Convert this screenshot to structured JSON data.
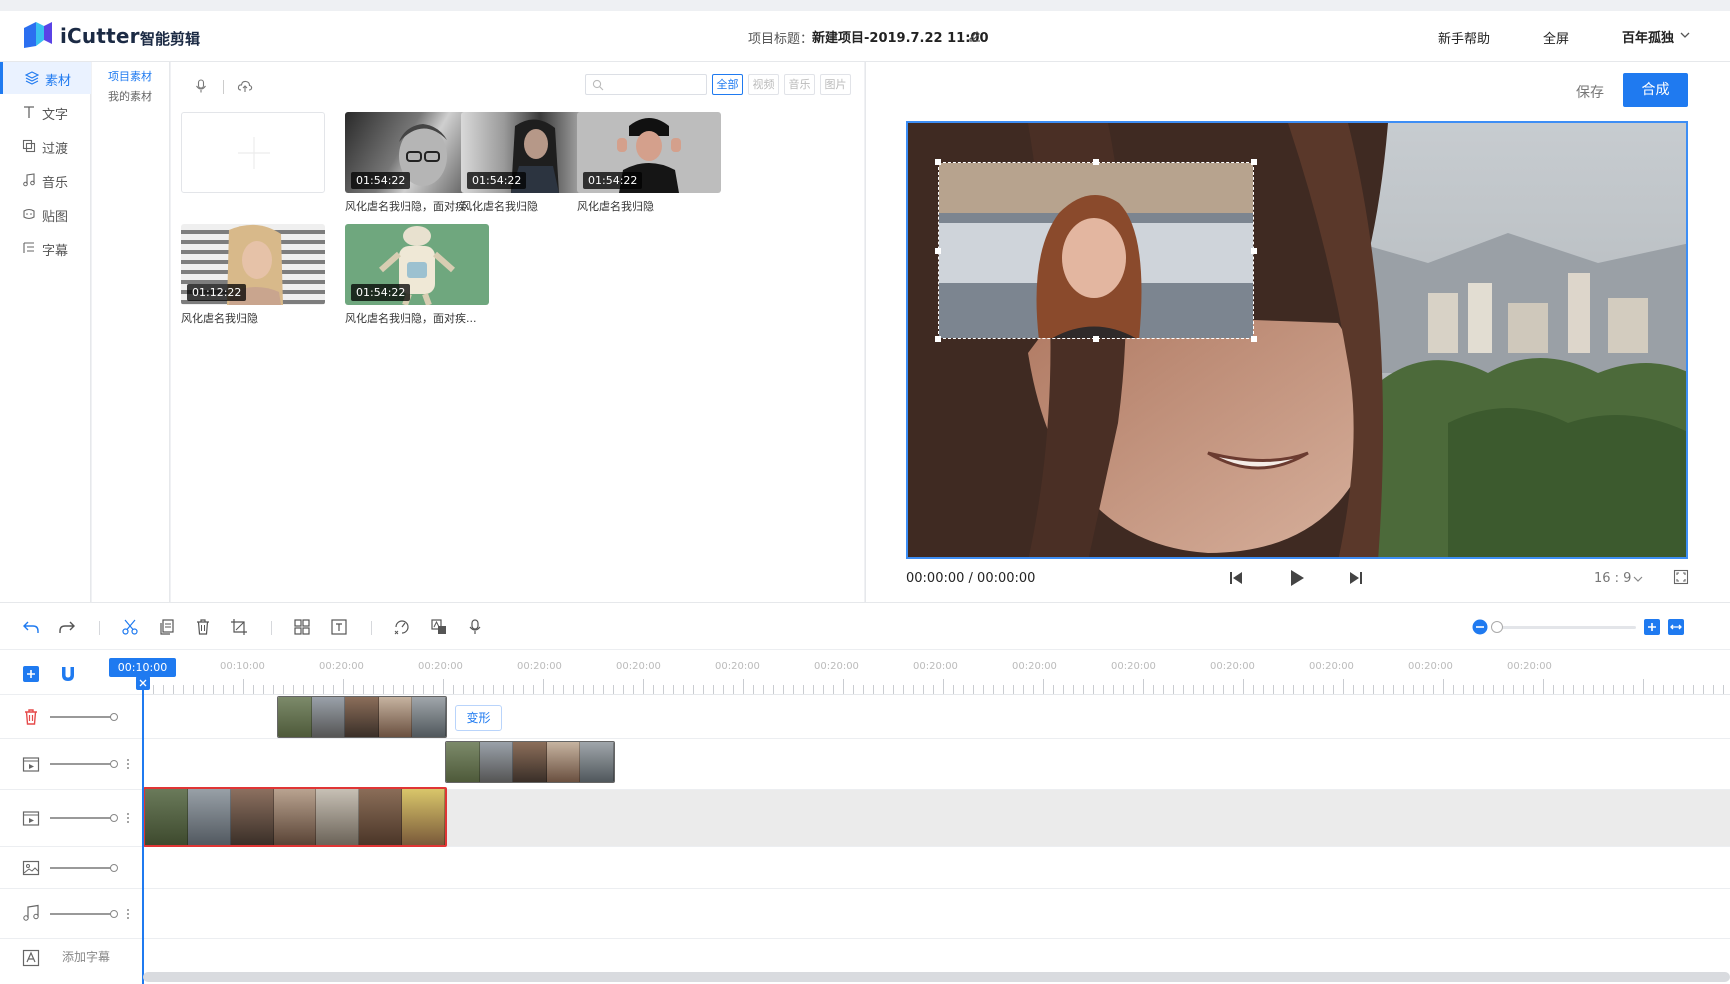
{
  "header": {
    "brand": "iCutter",
    "brand_sub": "智能剪辑",
    "project_label": "项目标题：",
    "project_name": "新建项目-2019.7.22 11:00",
    "nav_help": "新手帮助",
    "nav_fullscreen": "全屏",
    "user_name": "百年孤独"
  },
  "leftnav": {
    "items": [
      {
        "label": "素材",
        "icon": "layers-icon",
        "active": true
      },
      {
        "label": "文字",
        "icon": "text-icon"
      },
      {
        "label": "过渡",
        "icon": "transition-icon"
      },
      {
        "label": "音乐",
        "icon": "music-icon"
      },
      {
        "label": "贴图",
        "icon": "sticker-icon"
      },
      {
        "label": "字幕",
        "icon": "subtitle-icon"
      }
    ]
  },
  "subnav": {
    "items": [
      {
        "label": "项目素材",
        "active": true
      },
      {
        "label": "我的素材"
      }
    ]
  },
  "library": {
    "search_placeholder": "",
    "filters": [
      {
        "label": "全部",
        "active": true
      },
      {
        "label": "视频"
      },
      {
        "label": "音乐"
      },
      {
        "label": "图片"
      }
    ],
    "items": [
      {
        "duration": "01:54:22",
        "caption": "风化虐名我归隐，面对疾..."
      },
      {
        "duration": "01:54:22",
        "caption": "风化虐名我归隐"
      },
      {
        "duration": "01:54:22",
        "caption": "风化虐名我归隐"
      },
      {
        "duration": "01:12:22",
        "caption": "风化虐名我归隐"
      },
      {
        "duration": "01:54:22",
        "caption": "风化虐名我归隐，面对疾..."
      }
    ]
  },
  "preview": {
    "save_label": "保存",
    "compose_label": "合成",
    "time_current": "00:00:00",
    "time_separator": " / ",
    "time_total": "00:00:00",
    "aspect_ratio": "16 : 9"
  },
  "timeline": {
    "playhead_time": "00:10:00",
    "ruler_labels": [
      "00:10:00",
      "00:20:00",
      "00:20:00",
      "00:20:00",
      "00:20:00",
      "00:20:00",
      "00:20:00",
      "00:20:00",
      "00:20:00",
      "00:20:00",
      "00:20:00",
      "00:20:00",
      "00:20:00",
      "00:20:00"
    ],
    "morph_label": "变形",
    "add_subtitle_label": "添加字幕"
  },
  "colors": {
    "accent": "#1f7af0",
    "delete": "#e64a4a",
    "clip_selected_border": "#e03535"
  }
}
